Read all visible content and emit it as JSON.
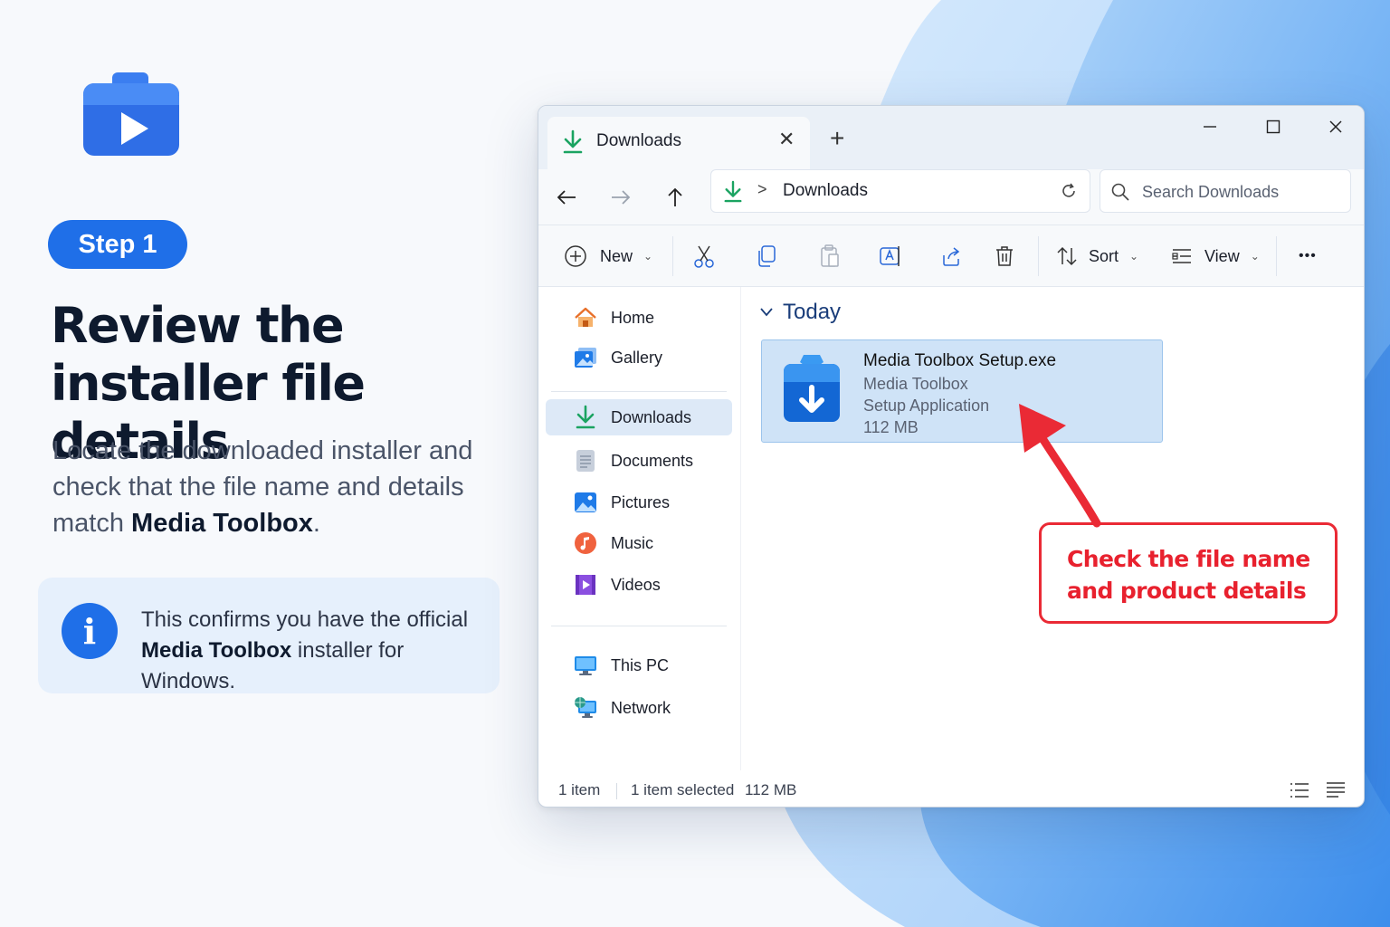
{
  "colors": {
    "accent": "#1f6fe8",
    "callout_red": "#ea2a35",
    "selection_fill": "#cfe3f7",
    "download_green": "#1aa361"
  },
  "left_panel": {
    "step_label": "Step 1",
    "headline_line1": "Review the",
    "headline_line2": "installer file details",
    "subtext_part1": "Locate the downloaded installer and check that the file name and details match ",
    "subtext_bold": "Media Toolbox",
    "subtext_end": ".",
    "info_icon": "info-icon",
    "info_part1": "This confirms you have the official ",
    "info_bold": "Media Toolbox",
    "info_part2": " installer for Windows."
  },
  "window": {
    "tab_title": "Downloads",
    "tab_icon": "download-arrow-icon",
    "new_tab": "+",
    "breadcrumb_separator": ">",
    "breadcrumb": "Downloads",
    "search_placeholder": "Search Downloads",
    "toolbar": {
      "new_label": "New",
      "sort_label": "Sort",
      "view_label": "View",
      "more_label": "•••"
    },
    "sidebar": [
      {
        "label": "Home",
        "icon": "home-icon"
      },
      {
        "label": "Gallery",
        "icon": "gallery-icon"
      },
      {
        "label": "Downloads",
        "icon": "download-arrow-icon",
        "selected": true
      },
      {
        "label": "Documents",
        "icon": "document-icon"
      },
      {
        "label": "Pictures",
        "icon": "pictures-icon"
      },
      {
        "label": "Music",
        "icon": "music-icon"
      },
      {
        "label": "Videos",
        "icon": "videos-icon"
      },
      {
        "label": "This PC",
        "icon": "monitor-icon"
      },
      {
        "label": "Network",
        "icon": "network-icon"
      }
    ],
    "group_header": "Today",
    "file": {
      "name": "Media Toolbox Setup.exe",
      "company": "Media Toolbox",
      "type": "Setup Application",
      "size": "112 MB"
    },
    "status": {
      "count": "1 item",
      "selected": "1 item selected",
      "selected_size": "112 MB"
    }
  },
  "annotation": {
    "callout_line1": "Check the file name",
    "callout_line2": "and product details"
  }
}
